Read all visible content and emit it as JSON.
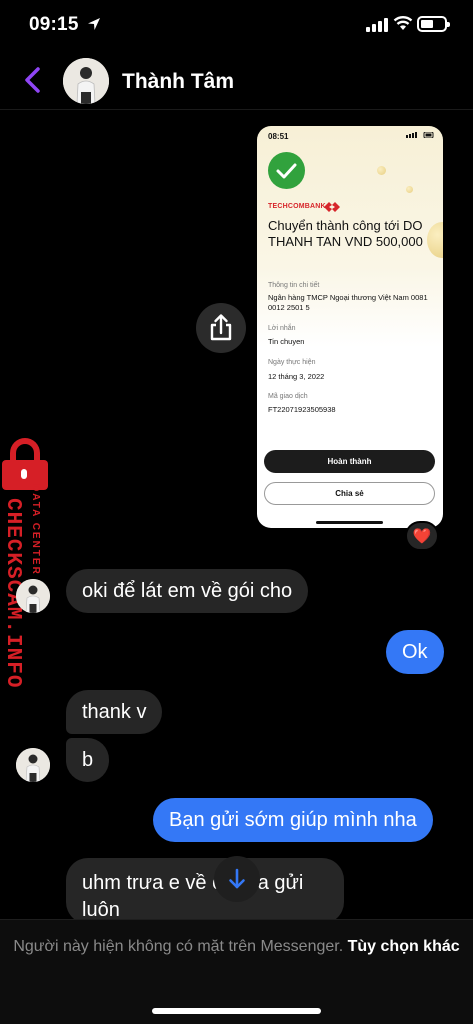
{
  "status_bar": {
    "time": "09:15"
  },
  "header": {
    "contact_name": "Thành Tâm"
  },
  "receipt": {
    "time": "08:51",
    "bank": "TECHCOMBANK",
    "title": "Chuyển thành công tới DO THANH TAN VND 500,000",
    "details_label": "Thông tin chi tiết",
    "details_value": "Ngân hàng TMCP Ngoại thương Việt Nam 0081 0012 2501 5",
    "message_label": "Lời nhắn",
    "message_value": "Tin chuyen",
    "date_label": "Ngày thực hiện",
    "date_value": "12 tháng 3, 2022",
    "txn_label": "Mã giao dịch",
    "txn_value": "FT22071923505938",
    "done_button": "Hoàn thành",
    "share_button": "Chia sẻ"
  },
  "reaction": "❤️",
  "watermark": {
    "text": "CHECKSCAM.INFO",
    "sub": "DATA CENTER"
  },
  "messages": [
    {
      "side": "in",
      "text": "oki để lát em về gói cho"
    },
    {
      "side": "out",
      "text": "Ok"
    },
    {
      "side": "in",
      "text": "thank v"
    },
    {
      "side": "in",
      "text": "b"
    },
    {
      "side": "out",
      "text": "Bạn gửi sớm giúp mình nha"
    },
    {
      "side": "in",
      "text": "uhm trưa e về   ong ra gửi luôn"
    }
  ],
  "footer": {
    "notice": "Người này hiện không có mặt trên Messenger.",
    "link": "Tùy chọn khác"
  }
}
